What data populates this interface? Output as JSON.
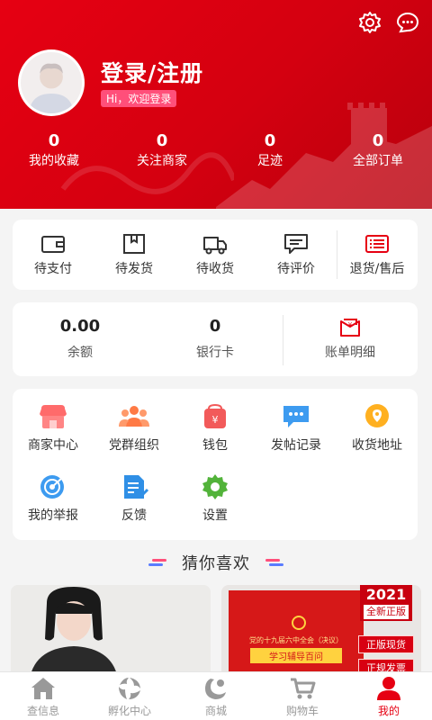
{
  "header": {
    "login_title": "登录/注册",
    "welcome": "Hi，欢迎登录",
    "icons": [
      "gear-icon",
      "chat-bubble-icon"
    ]
  },
  "stats": [
    {
      "value": "0",
      "label": "我的收藏"
    },
    {
      "value": "0",
      "label": "关注商家"
    },
    {
      "value": "0",
      "label": "足迹"
    },
    {
      "value": "0",
      "label": "全部订单"
    }
  ],
  "orders": [
    {
      "label": "待支付",
      "icon": "wallet-icon"
    },
    {
      "label": "待发货",
      "icon": "box-icon"
    },
    {
      "label": "待收货",
      "icon": "truck-icon"
    },
    {
      "label": "待评价",
      "icon": "comment-icon"
    },
    {
      "label": "退货/售后",
      "icon": "return-list-icon"
    }
  ],
  "wallet": [
    {
      "value": "0.00",
      "label": "余额"
    },
    {
      "value": "0",
      "label": "银行卡"
    },
    {
      "label": "账单明细",
      "icon": "bill-icon"
    }
  ],
  "services": [
    {
      "label": "商家中心",
      "icon": "shop-icon"
    },
    {
      "label": "党群组织",
      "icon": "group-icon"
    },
    {
      "label": "钱包",
      "icon": "purse-icon"
    },
    {
      "label": "发帖记录",
      "icon": "message-icon"
    },
    {
      "label": "收货地址",
      "icon": "location-icon"
    },
    {
      "label": "我的举报",
      "icon": "target-icon"
    },
    {
      "label": "反馈",
      "icon": "feedback-icon"
    },
    {
      "label": "设置",
      "icon": "settings-icon"
    }
  ],
  "guess": {
    "title": "猜你喜欢"
  },
  "products": [
    {
      "icon": "portrait-photo"
    },
    {
      "book_line1": "党的十九届六中全会（决议）",
      "book_line2": "学习辅导百问",
      "tag_year": "2021",
      "tag_sub": "全新正版",
      "badge1": "正版现货",
      "badge2": "正规发票"
    }
  ],
  "tabbar": [
    {
      "label": "查信息",
      "icon": "home-icon"
    },
    {
      "label": "孵化中心",
      "icon": "incubator-icon"
    },
    {
      "label": "商城",
      "icon": "mall-icon"
    },
    {
      "label": "购物车",
      "icon": "cart-icon"
    },
    {
      "label": "我的",
      "icon": "user-icon",
      "active": true
    }
  ],
  "colors": {
    "primary": "#e60012",
    "accent_pink": "#ff4f7a",
    "inactive": "#999999"
  }
}
